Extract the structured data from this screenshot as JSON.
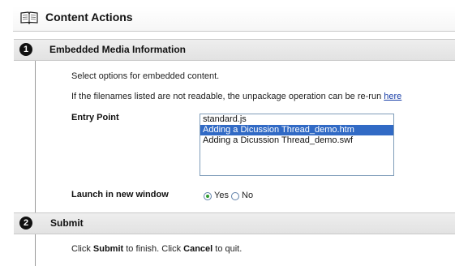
{
  "header": {
    "title": "Content Actions",
    "icon": "open-book-icon"
  },
  "step1": {
    "number": "1",
    "title": "Embedded Media Information",
    "instruction": "Select options for embedded content.",
    "note_prefix": "If the filenames listed are not readable, the unpackage operation can be re-run",
    "note_link": "here",
    "entry_point_label": "Entry Point",
    "entry_point_options": [
      "standard.js",
      "Adding a Dicussion Thread_demo.htm",
      "Adding a Dicussion Thread_demo.swf"
    ],
    "entry_point_selected_index": 1,
    "launch_label": "Launch in new window",
    "launch_options": [
      "Yes",
      "No"
    ],
    "launch_selected": "Yes"
  },
  "step2": {
    "number": "2",
    "title": "Submit",
    "text_1": "Click ",
    "submit_word": "Submit",
    "text_2": " to finish. Click ",
    "cancel_word": "Cancel",
    "text_3": " to quit."
  },
  "colors": {
    "selected_bg": "#316ac5",
    "link": "#1a3fa8",
    "radio_dot": "#2d9a2d"
  }
}
